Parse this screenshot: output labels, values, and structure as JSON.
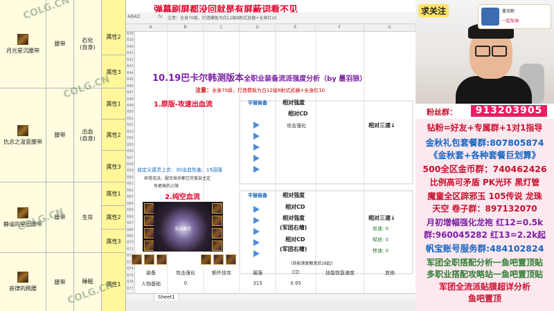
{
  "left_table": {
    "rows": [
      {
        "name": "月光星沉腰带",
        "type": "腰带",
        "source": "石化\n(自身)",
        "attrs": [
          "属性2",
          "属性3"
        ]
      },
      {
        "name": "仇念之温意腰带",
        "type": "腰带",
        "source": "出血\n(自身)",
        "attrs": [
          "属性1",
          "属性2",
          "属性3"
        ]
      },
      {
        "name": "静谧的星光腰带",
        "type": "腰带",
        "source": "生存",
        "attrs": [
          "属性1",
          "属性2",
          "属性3"
        ]
      },
      {
        "name": "音律的刷腰",
        "type": "腰带",
        "source": "睡眠",
        "attrs": [
          "属性1"
        ]
      }
    ],
    "watermark": "COLG.CN"
  },
  "sheet": {
    "banner": "弹幕刷屏都没回就是有屏蔽词看不见",
    "cell_ref": "A642",
    "fx": "fx",
    "formula": "注意：全身70级，打造模板为白12级8耐式武器+全身红10",
    "columns": [
      "A",
      "B",
      "C",
      "D",
      "E",
      "F",
      "G"
    ],
    "row_numbers": [
      "638",
      "639",
      "640",
      "641",
      "642",
      "643",
      "644",
      "645",
      "646",
      "647",
      "648",
      "649",
      "650",
      "651",
      "652",
      "653",
      "654",
      "655",
      "656",
      "657",
      "658",
      "659",
      "660",
      "661",
      "662",
      "663",
      "664",
      "665",
      "666",
      "667",
      "668",
      "669",
      "670",
      "671",
      "672",
      "673",
      "674",
      "675",
      "676",
      "677"
    ],
    "title_main": "10.19巴卡尔韩测版本",
    "title_sub": "全职业装备流派强度分析（by 墨羽狼）",
    "notice_label": "注意：",
    "notice_text": "全身70级，打造模板为白12级8耐式武器+全身红10",
    "section1": {
      "title": "1.原版-攻速出血流",
      "replace_label": "平替装备",
      "strength": "相对强度",
      "cd": "相对CD",
      "attack_enhance": "攻击强化",
      "three_speed": "相对三速↓",
      "custom_note": "自定义遗灵上衣：30出血伤害、15固强",
      "note2": "异常流派，配合抹杀都已完美自主定",
      "note3": "有更高的上限"
    },
    "section2": {
      "title": "2.纯空血流",
      "replace_label": "平替装备",
      "strength": "相对强度",
      "cd": "相对CD",
      "strength_corps": "相对强度",
      "corps_slot": "(军团右槽)",
      "cd_corps": "相对CD",
      "three_speed": "相对三速↓",
      "attack_speed": "攻速: 0",
      "cast_speed": "释放: 0",
      "move_speed": "移速: 0",
      "footnote": "(技能速度触发后28起)",
      "art_caption": "无法显示"
    },
    "bottom_headers": [
      "装备",
      "攻击强化",
      "额外技攻",
      "属强",
      "CD",
      "技能恢复速度",
      "其他"
    ],
    "bottom_row": [
      "人物基础",
      "0",
      "",
      "315",
      "0.95",
      "",
      ""
    ],
    "sheet_tab": "Sheet1"
  },
  "right_panel": {
    "follow_tag": "求关注",
    "fan_card_name": "墨羽狼",
    "fan_card_slogan": "一起加油",
    "fan_group_label": "粉丝群：",
    "fan_group_number": "913203905",
    "promos": [
      {
        "text": "钻粉=好友+专属群+1对1指导",
        "color": "#c8102e"
      },
      {
        "text": "金秋礼包套餐群:807805874",
        "color": "#1565c0"
      },
      {
        "text": "《金秋套+各种套餐巨划算》",
        "color": "#1565c0"
      },
      {
        "text": "500全区金币群：740462426",
        "color": "#c8102e"
      },
      {
        "text": "比例高可矛盾 PK光环 黑灯管",
        "color": "#c8102e"
      },
      {
        "text": "魔童全区辟邪玉 105传说 龙珠",
        "color": "#c8102e"
      },
      {
        "text": "天空 卷子群：897132070",
        "color": "#c8102e"
      },
      {
        "text": "月初增幅强化龙袍 红12=0.5k",
        "color": "#7b1fa2"
      },
      {
        "text": "群:960045282 红13=2.2k起",
        "color": "#7b1fa2"
      },
      {
        "text": "帆宝账号服务群:484102824",
        "color": "#1565c0"
      },
      {
        "text": "军团全职搭配分析一鱼吧置顶贴",
        "color": "#2e7d32"
      },
      {
        "text": "多职业搭配攻略站一鱼吧置顶贴",
        "color": "#2e7d32"
      },
      {
        "text": "军团全流派贴膜超详分析",
        "color": "#c8102e"
      },
      {
        "text": "鱼吧置顶",
        "color": "#c8102e"
      }
    ]
  }
}
